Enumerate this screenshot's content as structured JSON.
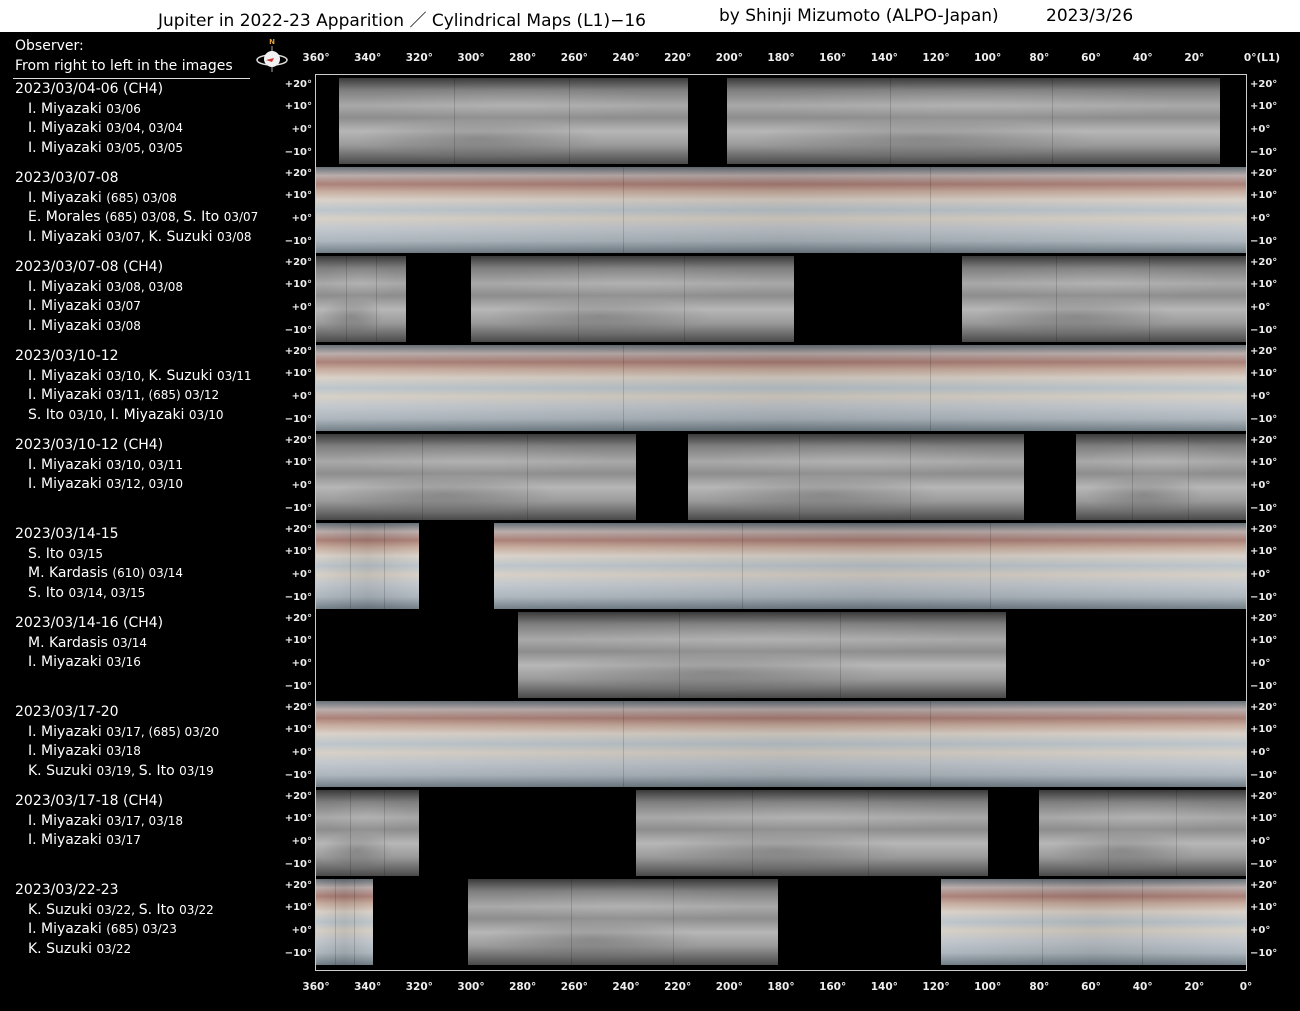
{
  "header": {
    "title": "Jupiter in 2022-23 Apparition ／ Cylindrical Maps (L1)−16",
    "author": "by Shinji Mizumoto (ALPO-Japan)",
    "date": "2023/3/26"
  },
  "observer_header": {
    "line1": "Observer:",
    "line2": "From right to left in the images"
  },
  "compass": {
    "north_label": "N"
  },
  "longitude_ticks": [
    "360°",
    "340°",
    "320°",
    "300°",
    "280°",
    "260°",
    "240°",
    "220°",
    "200°",
    "180°",
    "160°",
    "140°",
    "120°",
    "100°",
    "80°",
    "60°",
    "40°",
    "20°"
  ],
  "top_last_tick": "0°(L1)",
  "bottom_last_tick": "0°",
  "latitude_ticks": [
    "+20°",
    "+10°",
    "+0°",
    "−10°"
  ],
  "rows": [
    {
      "date": "2023/03/04-06 (CH4)",
      "observers": [
        {
          "name": "I. Miyazaki",
          "dates": "03/06"
        },
        {
          "name": "I. Miyazaki",
          "dates": "03/04, 03/04"
        },
        {
          "name": "I. Miyazaki",
          "dates": "03/05, 03/05"
        }
      ]
    },
    {
      "date": "2023/03/07-08",
      "observers": [
        {
          "name": "I. Miyazaki",
          "dates": "(685) 03/08"
        },
        {
          "name": "E. Morales",
          "dates": "(685) 03/08, ",
          "name2": "S. Ito",
          "dates2": "03/07"
        },
        {
          "name": "I. Miyazaki",
          "dates": "03/07, ",
          "name2": "K. Suzuki",
          "dates2": "03/08"
        }
      ]
    },
    {
      "date": "2023/03/07-08 (CH4)",
      "observers": [
        {
          "name": "I. Miyazaki",
          "dates": "03/08, 03/08"
        },
        {
          "name": "I. Miyazaki",
          "dates": "03/07"
        },
        {
          "name": "I. Miyazaki",
          "dates": "03/08"
        }
      ]
    },
    {
      "date": "2023/03/10-12",
      "observers": [
        {
          "name": "I. Miyazaki",
          "dates": "03/10, ",
          "name2": "K. Suzuki",
          "dates2": "03/11"
        },
        {
          "name": "I. Miyazaki",
          "dates": "03/11, (685) 03/12"
        },
        {
          "name": "S. Ito",
          "dates": "03/10, ",
          "name2": "I. Miyazaki",
          "dates2": "03/10"
        }
      ]
    },
    {
      "date": "2023/03/10-12 (CH4)",
      "observers": [
        {
          "name": "I. Miyazaki",
          "dates": "03/10, 03/11"
        },
        {
          "name": "I. Miyazaki",
          "dates": "03/12, 03/10"
        }
      ]
    },
    {
      "date": "2023/03/14-15",
      "observers": [
        {
          "name": "S. Ito",
          "dates": "03/15"
        },
        {
          "name": "M. Kardasis",
          "dates": "(610) 03/14"
        },
        {
          "name": "S. Ito",
          "dates": "03/14, 03/15"
        }
      ]
    },
    {
      "date": "2023/03/14-16 (CH4)",
      "observers": [
        {
          "name": "M. Kardasis",
          "dates": "03/14"
        },
        {
          "name": "I. Miyazaki",
          "dates": "03/16"
        }
      ]
    },
    {
      "date": "2023/03/17-20",
      "observers": [
        {
          "name": "I. Miyazaki",
          "dates": "03/17, (685) 03/20"
        },
        {
          "name": "I. Miyazaki",
          "dates": "03/18"
        },
        {
          "name": "K. Suzuki",
          "dates": "03/19, ",
          "name2": "S. Ito",
          "dates2": "03/19"
        }
      ]
    },
    {
      "date": "2023/03/17-18 (CH4)",
      "observers": [
        {
          "name": "I. Miyazaki",
          "dates": "03/17, 03/18"
        },
        {
          "name": "I. Miyazaki",
          "dates": "03/17"
        }
      ]
    },
    {
      "date": "2023/03/22-23",
      "observers": [
        {
          "name": "K. Suzuki",
          "dates": "03/22, ",
          "name2": "S. Ito",
          "dates2": "03/22"
        },
        {
          "name": "I. Miyazaki",
          "dates": "(685) 03/23"
        },
        {
          "name": "K. Suzuki",
          "dates": "03/22"
        }
      ]
    }
  ]
}
